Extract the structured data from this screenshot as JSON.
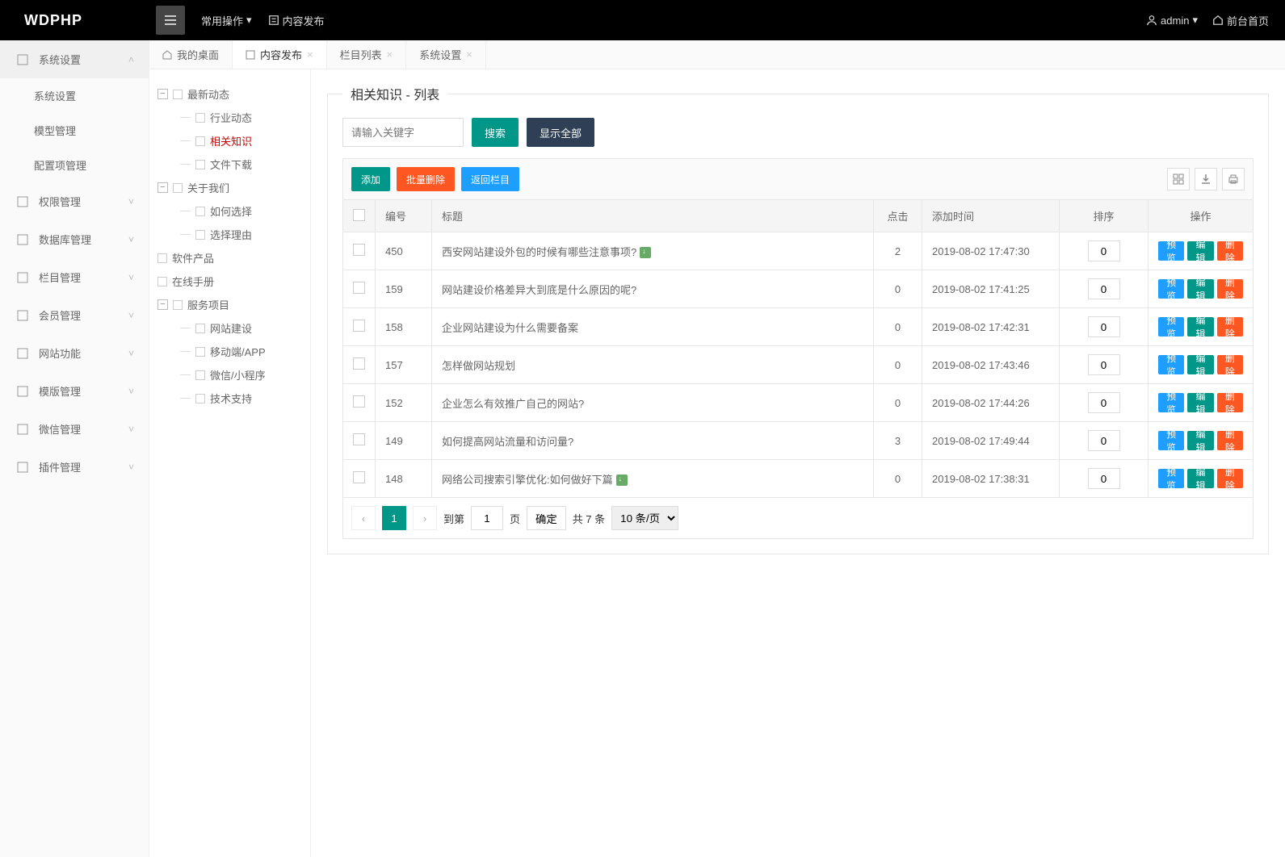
{
  "header": {
    "logo": "WDPHP",
    "menu1": "常用操作",
    "menu2": "内容发布",
    "user": "admin",
    "front": "前台首页"
  },
  "sidebar": [
    {
      "label": "系统设置",
      "expanded": true,
      "subs": [
        "系统设置",
        "模型管理",
        "配置项管理"
      ]
    },
    {
      "label": "权限管理"
    },
    {
      "label": "数据库管理"
    },
    {
      "label": "栏目管理"
    },
    {
      "label": "会员管理"
    },
    {
      "label": "网站功能"
    },
    {
      "label": "模版管理"
    },
    {
      "label": "微信管理"
    },
    {
      "label": "插件管理"
    }
  ],
  "tabs": [
    {
      "label": "我的桌面",
      "closable": false
    },
    {
      "label": "内容发布",
      "active": true,
      "closable": true
    },
    {
      "label": "栏目列表",
      "closable": true
    },
    {
      "label": "系统设置",
      "closable": true
    }
  ],
  "tree": [
    {
      "label": "最新动态",
      "type": "parent",
      "open": true
    },
    {
      "label": "行业动态",
      "type": "child"
    },
    {
      "label": "相关知识",
      "type": "child",
      "active": true
    },
    {
      "label": "文件下载",
      "type": "child"
    },
    {
      "label": "关于我们",
      "type": "parent",
      "open": true
    },
    {
      "label": "如何选择",
      "type": "child"
    },
    {
      "label": "选择理由",
      "type": "child"
    },
    {
      "label": "软件产品",
      "type": "leaf"
    },
    {
      "label": "在线手册",
      "type": "leaf"
    },
    {
      "label": "服务项目",
      "type": "parent",
      "open": true
    },
    {
      "label": "网站建设",
      "type": "child"
    },
    {
      "label": "移动端/APP",
      "type": "child"
    },
    {
      "label": "微信/小程序",
      "type": "child"
    },
    {
      "label": "技术支持",
      "type": "child"
    }
  ],
  "panel_title": "相关知识 - 列表",
  "search_placeholder": "请输入关键字",
  "btn_search": "搜索",
  "btn_showall": "显示全部",
  "btn_add": "添加",
  "btn_batchdel": "批量删除",
  "btn_backcol": "返回栏目",
  "cols": {
    "id": "编号",
    "title": "标题",
    "hits": "点击",
    "addtime": "添加时间",
    "sort": "排序",
    "ops": "操作"
  },
  "opbtn": {
    "preview": "预览",
    "edit": "编辑",
    "delete": "删除"
  },
  "rows": [
    {
      "id": "450",
      "title": "西安网站建设外包的时候有哪些注意事项?",
      "img": true,
      "hits": "2",
      "time": "2019-08-02 17:47:30",
      "sort": "0"
    },
    {
      "id": "159",
      "title": "网站建设价格差异大到底是什么原因的呢?",
      "img": false,
      "hits": "0",
      "time": "2019-08-02 17:41:25",
      "sort": "0"
    },
    {
      "id": "158",
      "title": "企业网站建设为什么需要备案",
      "img": false,
      "hits": "0",
      "time": "2019-08-02 17:42:31",
      "sort": "0"
    },
    {
      "id": "157",
      "title": "怎样做网站规划",
      "img": false,
      "hits": "0",
      "time": "2019-08-02 17:43:46",
      "sort": "0"
    },
    {
      "id": "152",
      "title": "企业怎么有效推广自己的网站?",
      "img": false,
      "hits": "0",
      "time": "2019-08-02 17:44:26",
      "sort": "0"
    },
    {
      "id": "149",
      "title": "如何提高网站流量和访问量?",
      "img": false,
      "hits": "3",
      "time": "2019-08-02 17:49:44",
      "sort": "0"
    },
    {
      "id": "148",
      "title": "网络公司搜索引擎优化:如何做好下篇",
      "img": true,
      "hits": "0",
      "time": "2019-08-02 17:38:31",
      "sort": "0"
    }
  ],
  "pager": {
    "goto": "到第",
    "page_label": "页",
    "ok": "确定",
    "total": "共 7 条",
    "persel": "10 条/页",
    "current": "1",
    "input": "1"
  }
}
